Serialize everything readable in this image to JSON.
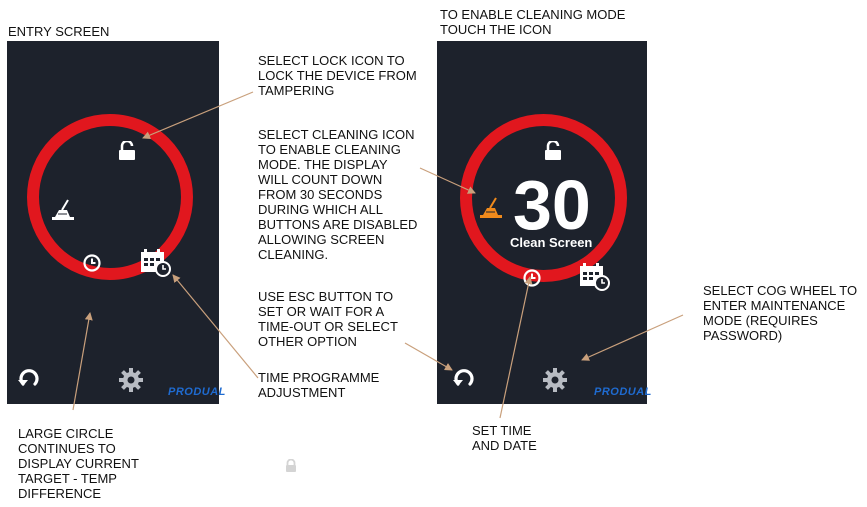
{
  "headings": {
    "left": "ENTRY SCREEN",
    "right": "TO ENABLE CLEANING MODE\nTOUCH THE ICON"
  },
  "annotations": {
    "lock": "SELECT LOCK ICON TO\nLOCK THE DEVICE FROM\nTAMPERING",
    "cleaning": "SELECT CLEANING ICON\nTO ENABLE CLEANING\nMODE. THE DISPLAY\nWILL COUNT DOWN\nFROM 30 SECONDS\nDURING WHICH ALL\nBUTTONS ARE DISABLED\nALLOWING SCREEN\nCLEANING.",
    "esc": "USE ESC BUTTON TO\nSET  OR WAIT FOR A\nTIME-OUT OR SELECT\nOTHER OPTION",
    "time_programme": "TIME PROGRAMME\nADJUSTMENT",
    "large_circle": "LARGE CIRCLE\nCONTINUES TO\nDISPLAY CURRENT\nTARGET - TEMP\nDIFFERENCE",
    "set_time": "SET TIME\nAND DATE",
    "cog": "SELECT COG WHEEL TO\nENTER MAINTENANCE\nMODE (REQUIRES\nPASSWORD)"
  },
  "screens": {
    "entry": {
      "brand": "PRODUAL"
    },
    "cleaning": {
      "countdown": "30",
      "label": "Clean Screen",
      "brand": "PRODUAL"
    }
  },
  "colors": {
    "screen_bg": "#1d222c",
    "ring": "#e1171e",
    "cleaning_active": "#f08a1c",
    "brand": "#1f6bd0",
    "arrow": "#c9a07c"
  }
}
